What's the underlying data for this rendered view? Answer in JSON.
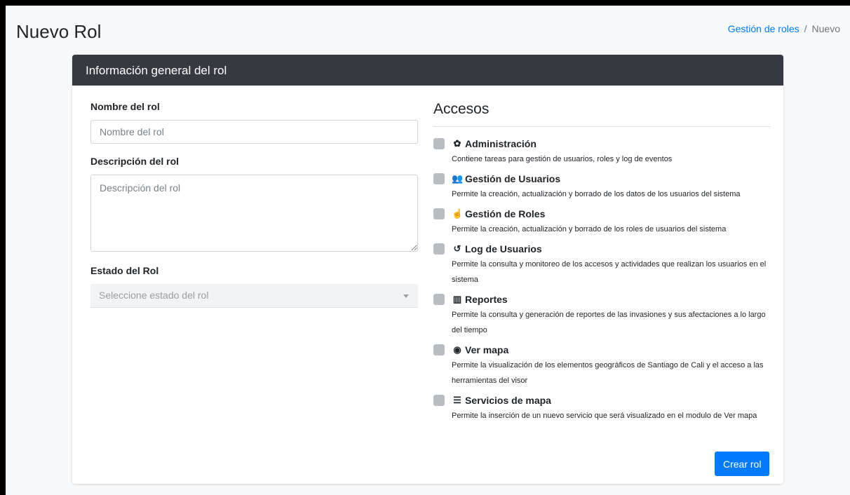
{
  "page": {
    "title": "Nuevo Rol",
    "breadcrumb": {
      "parent": "Gestión de roles",
      "separator": "/",
      "current": "Nuevo"
    }
  },
  "card": {
    "header": "Información general del rol",
    "form": {
      "name_label": "Nombre del rol",
      "name_placeholder": "Nombre del rol",
      "name_value": "",
      "description_label": "Descripción del rol",
      "description_placeholder": "Descripción del rol",
      "description_value": "",
      "status_label": "Estado del Rol",
      "status_placeholder": "Seleccione estado del rol"
    },
    "access": {
      "title": "Accesos",
      "items": [
        {
          "icon": "gear-icon",
          "glyph": "✿",
          "label": "Administración",
          "description": "Contiene tareas para gestión de usuarios, roles y log de eventos",
          "checked": false
        },
        {
          "icon": "users-icon",
          "glyph": "👥",
          "label": "Gestión de Usuarios",
          "description": "Permite la creación, actualización y borrado de los datos de los usuarios del sistema",
          "checked": false
        },
        {
          "icon": "hand-icon",
          "glyph": "☝",
          "label": "Gestión de Roles",
          "description": "Permite la creación, actualización y borrado de los roles de usuarios del sistema",
          "checked": false
        },
        {
          "icon": "history-icon",
          "glyph": "↺",
          "label": "Log de Usuarios",
          "description": "Permite la consulta y monitoreo de los accesos y actividades que realizan los usuarios en el sistema",
          "checked": false
        },
        {
          "icon": "bar-chart-icon",
          "glyph": "▥",
          "label": "Reportes",
          "description": "Permite la consulta y generación de reportes de las invasiones y sus afectaciones a lo largo del tiempo",
          "checked": false
        },
        {
          "icon": "globe-icon",
          "glyph": "◉",
          "label": "Ver mapa",
          "description": "Permite la visualización de los elementos geográficos de Santiago de Cali y el acceso a las herramientas del visor",
          "checked": false
        },
        {
          "icon": "server-icon",
          "glyph": "☰",
          "label": "Servicios de mapa",
          "description": "Permite la inserción de un nuevo servicio que será visualizado en el modulo de Ver mapa",
          "checked": false
        }
      ]
    },
    "submit_label": "Crear rol"
  },
  "colors": {
    "primary": "#007bff",
    "header_bg": "#343a40",
    "checkbox": "#b9bdc1",
    "page_bg": "#f8f9fa"
  }
}
